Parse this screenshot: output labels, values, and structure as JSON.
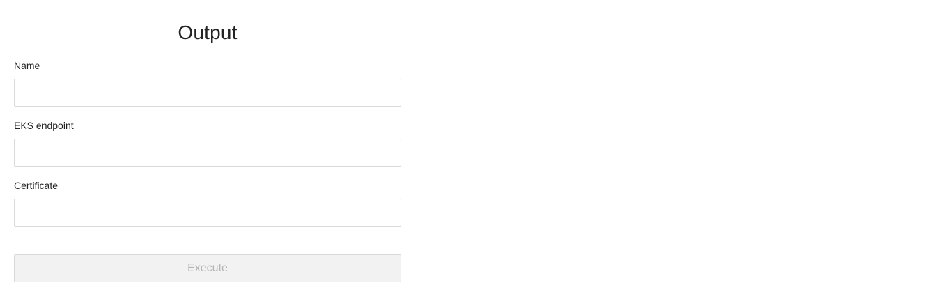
{
  "form": {
    "title": "Output",
    "fields": [
      {
        "label": "Name",
        "value": "",
        "placeholder": ""
      },
      {
        "label": "EKS endpoint",
        "value": "",
        "placeholder": ""
      },
      {
        "label": "Certificate",
        "value": "",
        "placeholder": ""
      }
    ],
    "submit_label": "Execute",
    "submit_disabled": true
  }
}
